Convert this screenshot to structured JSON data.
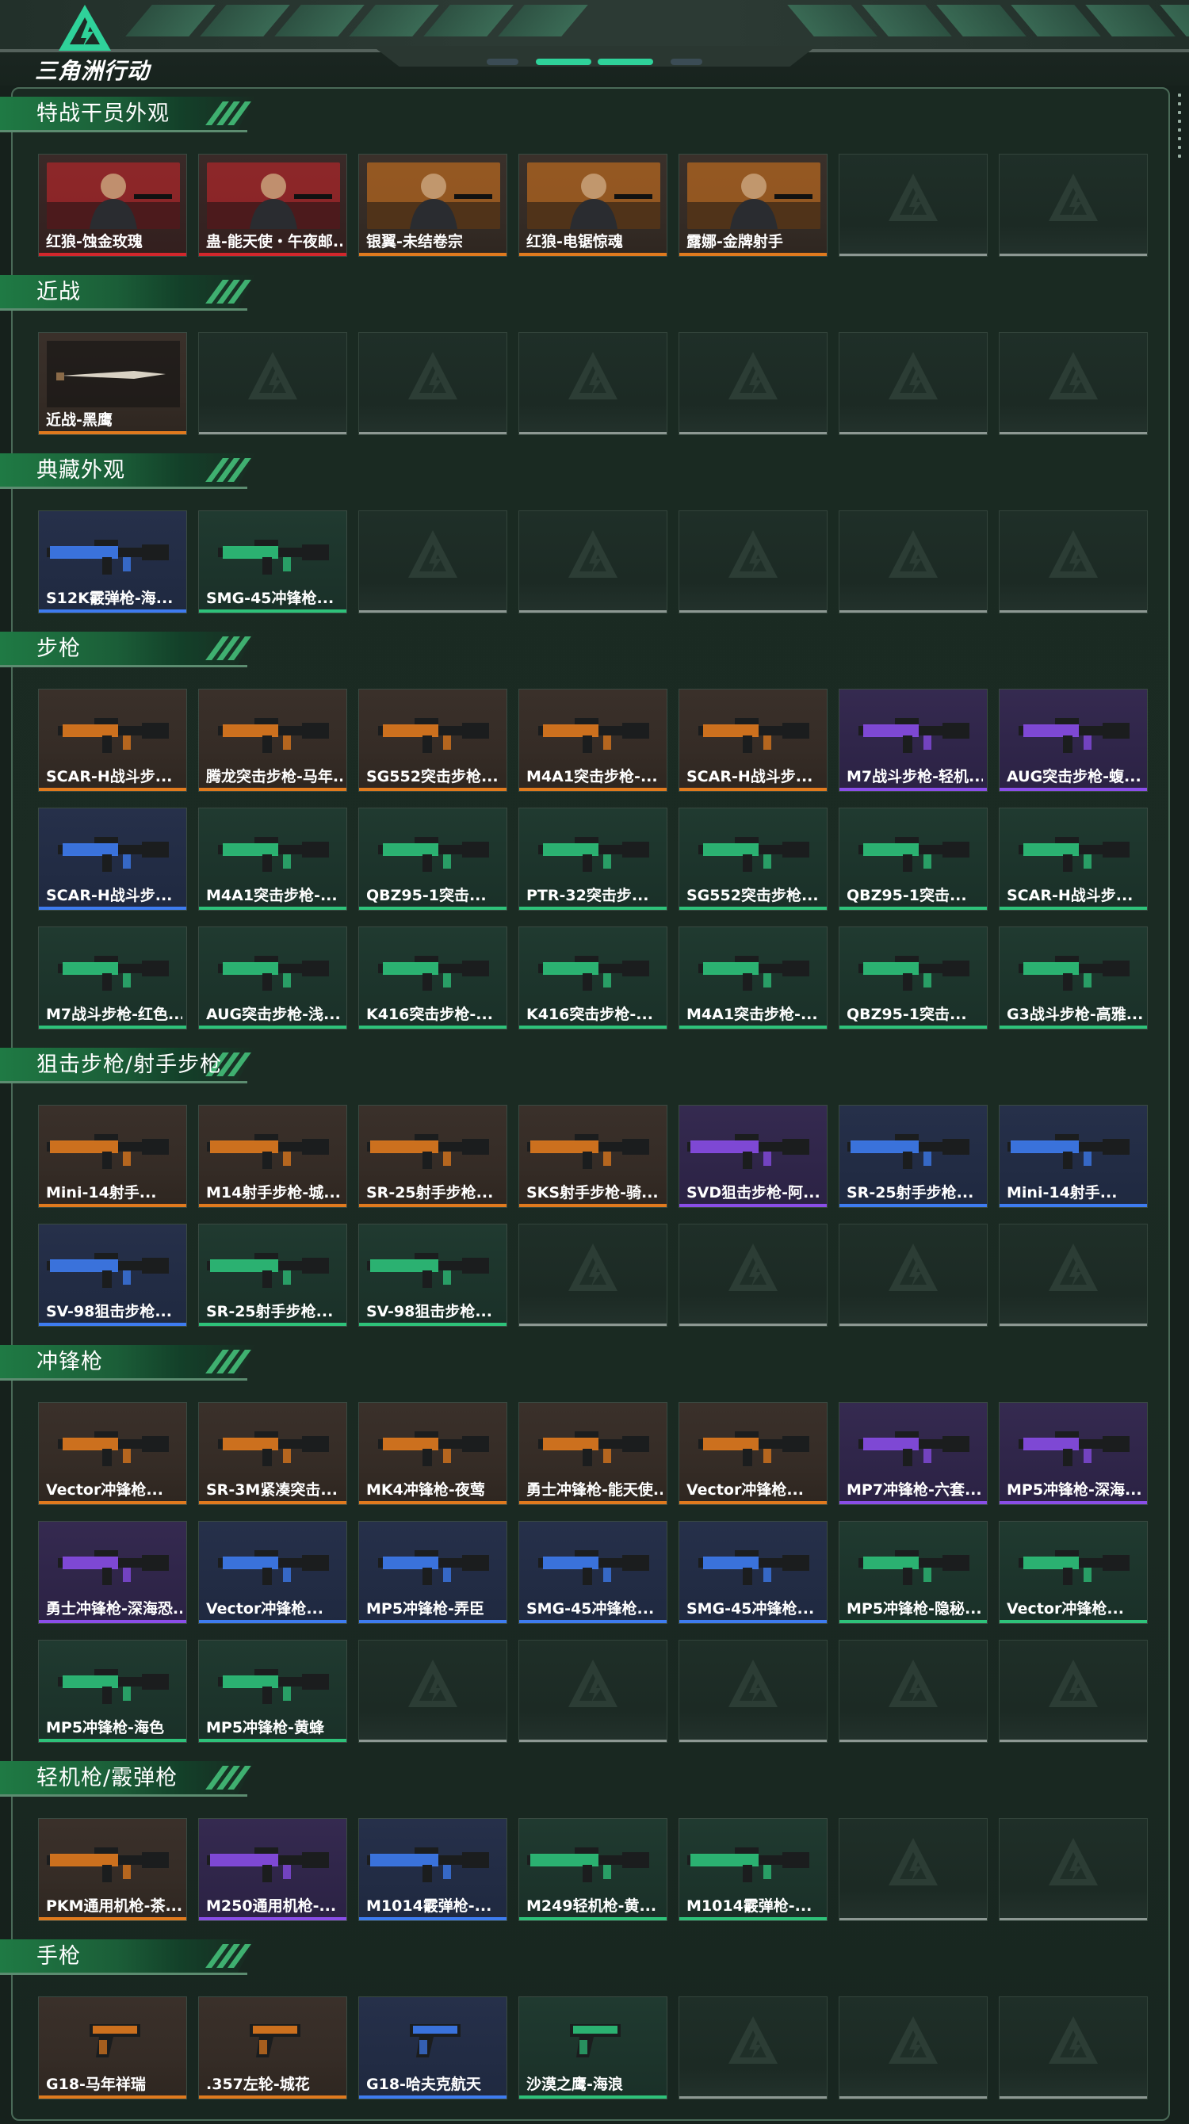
{
  "app": {
    "logo_text": "三角洲行动",
    "logo_icon": "delta-triangle-logo",
    "accent_color": "#2fd29a"
  },
  "rarity_colors": {
    "orange": "#e07a1e",
    "red": "#d2272c",
    "blue": "#3e7cf0",
    "purple": "#8a4ee8",
    "green": "#2ec27a",
    "empty": "#8d9893"
  },
  "sections": [
    {
      "title": "特战干员外观",
      "items": [
        {
          "name": "红狼-蚀金玫瑰",
          "rarity": "red",
          "kind": "operator"
        },
        {
          "name": "蛊-能天使・午夜邮...",
          "rarity": "red",
          "kind": "operator"
        },
        {
          "name": "银翼-未结卷宗",
          "rarity": "orange",
          "kind": "operator"
        },
        {
          "name": "红狼-电锯惊魂",
          "rarity": "orange",
          "kind": "operator"
        },
        {
          "name": "露娜-金牌射手",
          "rarity": "orange",
          "kind": "operator"
        }
      ],
      "slots": 7
    },
    {
      "title": "近战",
      "items": [
        {
          "name": "近战-黑鹰",
          "rarity": "orange",
          "kind": "knife"
        }
      ],
      "slots": 7
    },
    {
      "title": "典藏外观",
      "items": [
        {
          "name": "S12K霰弹枪-海...",
          "rarity": "blue",
          "kind": "shotgun"
        },
        {
          "name": "SMG-45冲锋枪...",
          "rarity": "green",
          "kind": "smg"
        }
      ],
      "slots": 7
    },
    {
      "title": "步枪",
      "items": [
        {
          "name": "SCAR-H战斗步...",
          "rarity": "orange",
          "kind": "rifle"
        },
        {
          "name": "腾龙突击步枪-马年...",
          "rarity": "orange",
          "kind": "rifle"
        },
        {
          "name": "SG552突击步枪...",
          "rarity": "orange",
          "kind": "rifle"
        },
        {
          "name": "M4A1突击步枪-...",
          "rarity": "orange",
          "kind": "rifle"
        },
        {
          "name": "SCAR-H战斗步...",
          "rarity": "orange",
          "kind": "rifle"
        },
        {
          "name": "M7战斗步枪-轻机...",
          "rarity": "purple",
          "kind": "rifle"
        },
        {
          "name": "AUG突击步枪-蝮...",
          "rarity": "purple",
          "kind": "rifle"
        },
        {
          "name": "SCAR-H战斗步...",
          "rarity": "blue",
          "kind": "rifle"
        },
        {
          "name": "M4A1突击步枪-...",
          "rarity": "green",
          "kind": "rifle"
        },
        {
          "name": "QBZ95-1突击...",
          "rarity": "green",
          "kind": "rifle"
        },
        {
          "name": "PTR-32突击步...",
          "rarity": "green",
          "kind": "rifle"
        },
        {
          "name": "SG552突击步枪...",
          "rarity": "green",
          "kind": "rifle"
        },
        {
          "name": "QBZ95-1突击...",
          "rarity": "green",
          "kind": "rifle"
        },
        {
          "name": "SCAR-H战斗步...",
          "rarity": "green",
          "kind": "rifle"
        },
        {
          "name": "M7战斗步枪-红色...",
          "rarity": "green",
          "kind": "rifle"
        },
        {
          "name": "AUG突击步枪-浅...",
          "rarity": "green",
          "kind": "rifle"
        },
        {
          "name": "K416突击步枪-...",
          "rarity": "green",
          "kind": "rifle"
        },
        {
          "name": "K416突击步枪-...",
          "rarity": "green",
          "kind": "rifle"
        },
        {
          "name": "M4A1突击步枪-...",
          "rarity": "green",
          "kind": "rifle"
        },
        {
          "name": "QBZ95-1突击...",
          "rarity": "green",
          "kind": "rifle"
        },
        {
          "name": "G3战斗步枪-高雅...",
          "rarity": "green",
          "kind": "rifle"
        }
      ],
      "slots": 21
    },
    {
      "title": "狙击步枪/射手步枪",
      "items": [
        {
          "name": "Mini-14射手...",
          "rarity": "orange",
          "kind": "sniper"
        },
        {
          "name": "M14射手步枪-城...",
          "rarity": "orange",
          "kind": "sniper"
        },
        {
          "name": "SR-25射手步枪...",
          "rarity": "orange",
          "kind": "sniper"
        },
        {
          "name": "SKS射手步枪-骑...",
          "rarity": "orange",
          "kind": "sniper"
        },
        {
          "name": "SVD狙击步枪-阿...",
          "rarity": "purple",
          "kind": "sniper"
        },
        {
          "name": "SR-25射手步枪...",
          "rarity": "blue",
          "kind": "sniper"
        },
        {
          "name": "Mini-14射手...",
          "rarity": "blue",
          "kind": "sniper"
        },
        {
          "name": "SV-98狙击步枪...",
          "rarity": "blue",
          "kind": "sniper"
        },
        {
          "name": "SR-25射手步枪...",
          "rarity": "green",
          "kind": "sniper"
        },
        {
          "name": "SV-98狙击步枪...",
          "rarity": "green",
          "kind": "sniper"
        }
      ],
      "slots": 14
    },
    {
      "title": "冲锋枪",
      "items": [
        {
          "name": "Vector冲锋枪...",
          "rarity": "orange",
          "kind": "smg"
        },
        {
          "name": "SR-3M紧凑突击...",
          "rarity": "orange",
          "kind": "smg"
        },
        {
          "name": "MK4冲锋枪-夜莺",
          "rarity": "orange",
          "kind": "smg"
        },
        {
          "name": "勇士冲锋枪-能天使...",
          "rarity": "orange",
          "kind": "smg"
        },
        {
          "name": "Vector冲锋枪...",
          "rarity": "orange",
          "kind": "smg"
        },
        {
          "name": "MP7冲锋枪-六套...",
          "rarity": "purple",
          "kind": "smg"
        },
        {
          "name": "MP5冲锋枪-深海...",
          "rarity": "purple",
          "kind": "smg"
        },
        {
          "name": "勇士冲锋枪-深海恐...",
          "rarity": "purple",
          "kind": "smg"
        },
        {
          "name": "Vector冲锋枪...",
          "rarity": "blue",
          "kind": "smg"
        },
        {
          "name": "MP5冲锋枪-弄臣",
          "rarity": "blue",
          "kind": "smg"
        },
        {
          "name": "SMG-45冲锋枪...",
          "rarity": "blue",
          "kind": "smg"
        },
        {
          "name": "SMG-45冲锋枪...",
          "rarity": "blue",
          "kind": "smg"
        },
        {
          "name": "MP5冲锋枪-隐秘...",
          "rarity": "green",
          "kind": "smg"
        },
        {
          "name": "Vector冲锋枪...",
          "rarity": "green",
          "kind": "smg"
        },
        {
          "name": "MP5冲锋枪-海色",
          "rarity": "green",
          "kind": "smg"
        },
        {
          "name": "MP5冲锋枪-黄蜂",
          "rarity": "green",
          "kind": "smg"
        }
      ],
      "slots": 21
    },
    {
      "title": "轻机枪/霰弹枪",
      "items": [
        {
          "name": "PKM通用机枪-茶...",
          "rarity": "orange",
          "kind": "lmg"
        },
        {
          "name": "M250通用机枪-...",
          "rarity": "purple",
          "kind": "lmg"
        },
        {
          "name": "M1014霰弹枪-...",
          "rarity": "blue",
          "kind": "shotgun"
        },
        {
          "name": "M249轻机枪-黄...",
          "rarity": "green",
          "kind": "lmg"
        },
        {
          "name": "M1014霰弹枪-...",
          "rarity": "green",
          "kind": "shotgun"
        }
      ],
      "slots": 7
    },
    {
      "title": "手枪",
      "items": [
        {
          "name": "G18-马年祥瑞",
          "rarity": "orange",
          "kind": "pistol"
        },
        {
          "name": ".357左轮-城花",
          "rarity": "orange",
          "kind": "pistol"
        },
        {
          "name": "G18-哈夫克航天",
          "rarity": "blue",
          "kind": "pistol"
        },
        {
          "name": "沙漠之鹰-海浪",
          "rarity": "green",
          "kind": "pistol"
        }
      ],
      "slots": 7
    }
  ]
}
